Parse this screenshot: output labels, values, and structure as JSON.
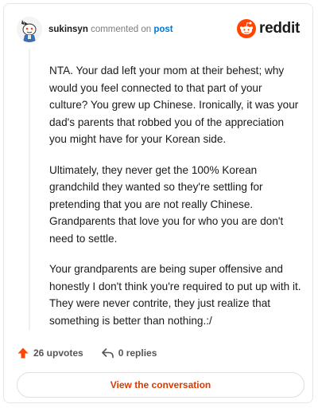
{
  "header": {
    "username": "sukinsyn",
    "action_text": "commented on",
    "post_link": "post",
    "brand": "reddit",
    "avatar_icon": "snoo-avatar-icon",
    "brand_icon": "reddit-snoo-icon"
  },
  "comment": {
    "paragraphs": [
      "NTA. Your dad left your mom at their behest; why would you feel connected to that part of your culture? You grew up Chinese. Ironically, it was your dad's parents that robbed you of the appreciation you might have for your Korean side.",
      "Ultimately, they never get the 100% Korean grandchild they wanted so they're settling for pretending that you are not really Chinese. Grandparents that love you for who you are don't need to settle.",
      "Your grandparents are being super offensive and honestly I don't think you're required to put up with it. They were never contrite, they just realize that something is better than nothing.:/"
    ]
  },
  "actions": {
    "upvotes_label": "26 upvotes",
    "replies_label": "0 replies",
    "upvote_icon": "upvote-arrow-icon",
    "reply_icon": "reply-arrow-icon"
  },
  "cta": {
    "view_label": "View the conversation"
  },
  "colors": {
    "accent": "#ff4500",
    "link": "#0079d3",
    "cta_text": "#d93a00"
  }
}
